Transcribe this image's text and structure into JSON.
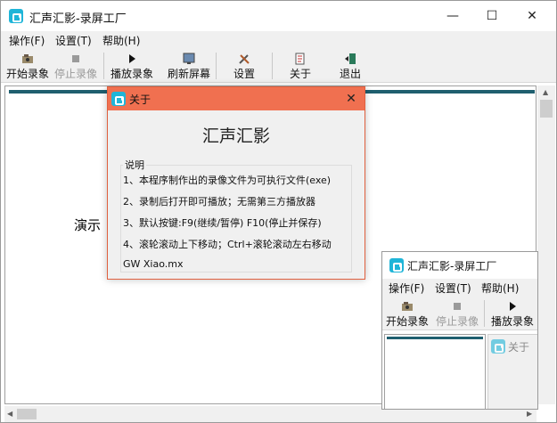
{
  "window": {
    "title": "汇声汇影-录屏工厂",
    "controls": {
      "minimize": "—",
      "maximize": "☐",
      "close": "✕"
    }
  },
  "menu": [
    "操作(F)",
    "设置(T)",
    "帮助(H)"
  ],
  "toolbar": {
    "start": "开始录象",
    "stop": "停止录像",
    "play": "播放录象",
    "refresh": "刷新屏幕",
    "settings": "设置",
    "about": "关于",
    "exit": "退出"
  },
  "content": {
    "demo_label": "演示"
  },
  "about_dialog": {
    "title": "关于",
    "heading": "汇声汇影",
    "group_label": "说明",
    "lines": [
      "1、本程序制作出的录像文件为可执行文件(exe)",
      "2、录制后打开即可播放；无需第三方播放器",
      "3、默认按键:F9(继续/暂停) F10(停止并保存)",
      "4、滚轮滚动上下移动；Ctrl+滚轮滚动左右移动",
      "GW  Xiao.mx"
    ],
    "close": "✕"
  },
  "preview_window": {
    "title": "汇声汇影-录屏工厂",
    "menu": [
      "操作(F)",
      "设置(T)",
      "帮助(H)"
    ],
    "toolbar": {
      "start": "开始录象",
      "stop": "停止录像",
      "play": "播放录象"
    },
    "dialog_title": "关于"
  },
  "colors": {
    "dialog_title_bar": "#f07050",
    "app_icon": "#1fb5d8",
    "content_strip": "#1f5f6f"
  }
}
